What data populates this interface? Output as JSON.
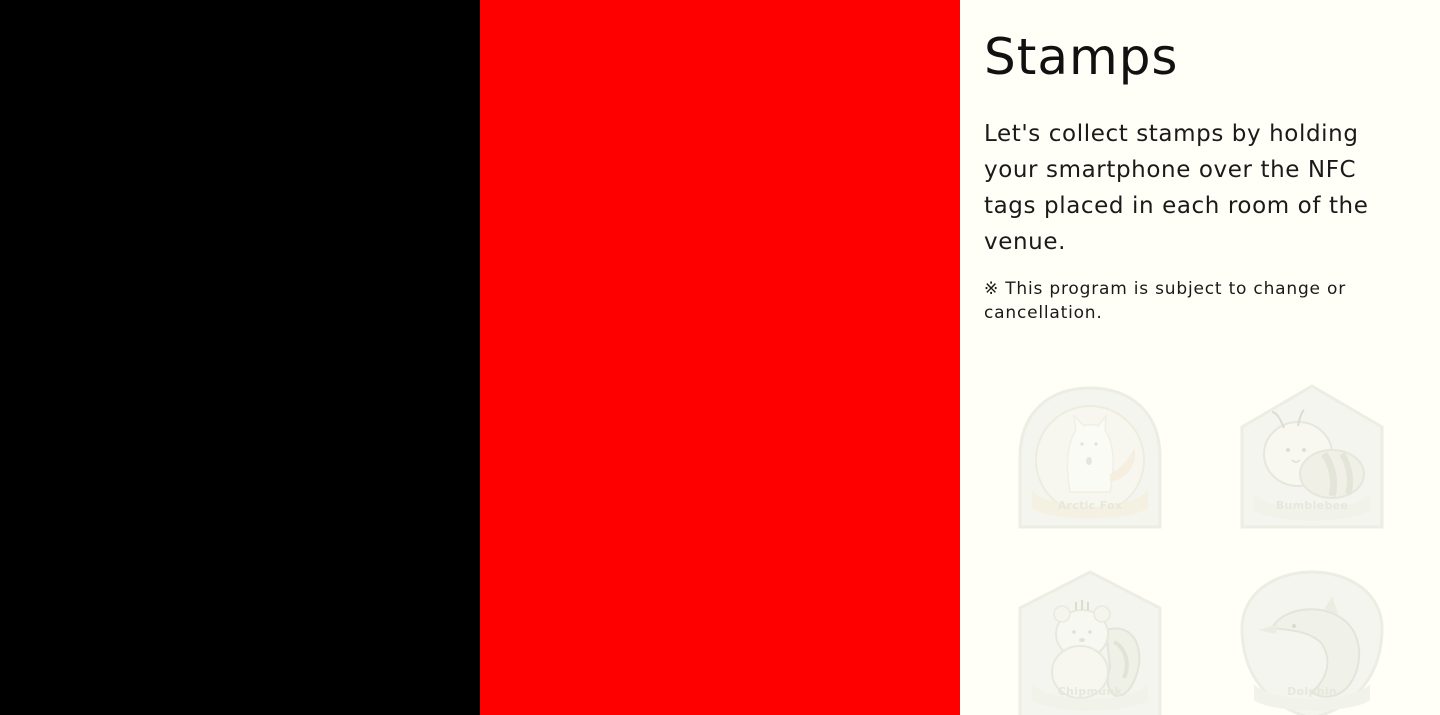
{
  "colors": {
    "left_panel": "#000000",
    "middle_panel": "#ff0000",
    "right_panel": "#fffff7"
  },
  "stamps_section": {
    "title": "Stamps",
    "description": "Let's collect stamps by holding your smartphone over the NFC tags placed in each room of the venue.",
    "note": "※ This program is subject to change or cancellation.",
    "stamps": [
      {
        "label": "Arctic Fox",
        "icon": "arctic-fox-icon"
      },
      {
        "label": "Bumblebee",
        "icon": "bumblebee-icon"
      },
      {
        "label": "Chipmunk",
        "icon": "chipmunk-icon"
      },
      {
        "label": "Dolphin",
        "icon": "dolphin-icon"
      }
    ]
  }
}
